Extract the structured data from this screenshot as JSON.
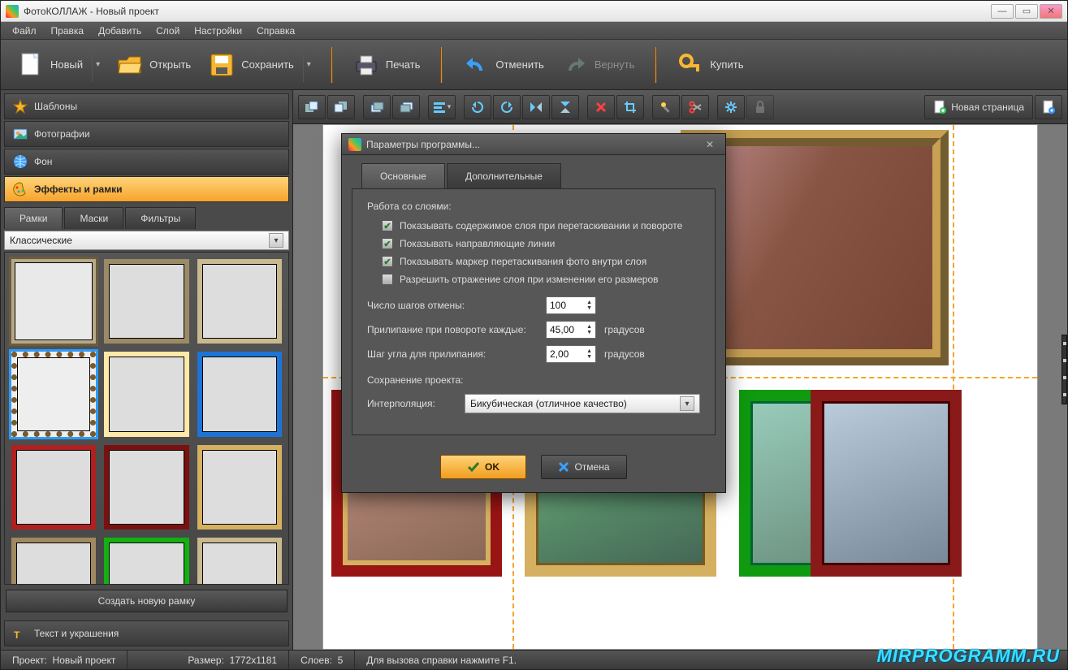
{
  "title": "ФотоКОЛЛАЖ - Новый проект",
  "menu": [
    "Файл",
    "Правка",
    "Добавить",
    "Слой",
    "Настройки",
    "Справка"
  ],
  "toolbar": {
    "new": "Новый",
    "open": "Открыть",
    "save": "Сохранить",
    "print": "Печать",
    "undo": "Отменить",
    "redo": "Вернуть",
    "buy": "Купить"
  },
  "sidebar": {
    "templates": "Шаблоны",
    "photos": "Фотографии",
    "background": "Фон",
    "effects": "Эффекты и рамки",
    "textdeco": "Текст и украшения"
  },
  "subtabs": {
    "frames": "Рамки",
    "masks": "Маски",
    "filters": "Фильтры"
  },
  "frame_category": "Классические",
  "new_frame_btn": "Создать новую рамку",
  "canvas_toolbar": {
    "newpage": "Новая страница"
  },
  "dialog": {
    "title": "Параметры программы...",
    "tabs": {
      "main": "Основные",
      "extra": "Дополнительные"
    },
    "group_layers": "Работа со слоями:",
    "chk1": "Показывать содержимое слоя при перетаскивании и повороте",
    "chk2": "Показывать направляющие линии",
    "chk3": "Показывать маркер перетаскивания фото внутри слоя",
    "chk4": "Разрешить отражение слоя при изменении его размеров",
    "undo_steps_label": "Число шагов отмены:",
    "undo_steps_value": "100",
    "snap_rotate_label": "Прилипание при повороте каждые:",
    "snap_rotate_value": "45,00",
    "degrees": "градусов",
    "snap_angle_label": "Шаг угла для прилипания:",
    "snap_angle_value": "2,00",
    "group_save": "Сохранение проекта:",
    "interpolation_label": "Интерполяция:",
    "interpolation_value": "Бикубическая (отличное качество)",
    "ok": "OK",
    "cancel": "Отмена"
  },
  "status": {
    "project_label": "Проект:",
    "project_value": "Новый проект",
    "size_label": "Размер:",
    "size_value": "1772x1181",
    "layers_label": "Слоев:",
    "layers_value": "5",
    "help": "Для вызова справки нажмите F1."
  },
  "watermark": "MIRPROGRAMM.RU"
}
